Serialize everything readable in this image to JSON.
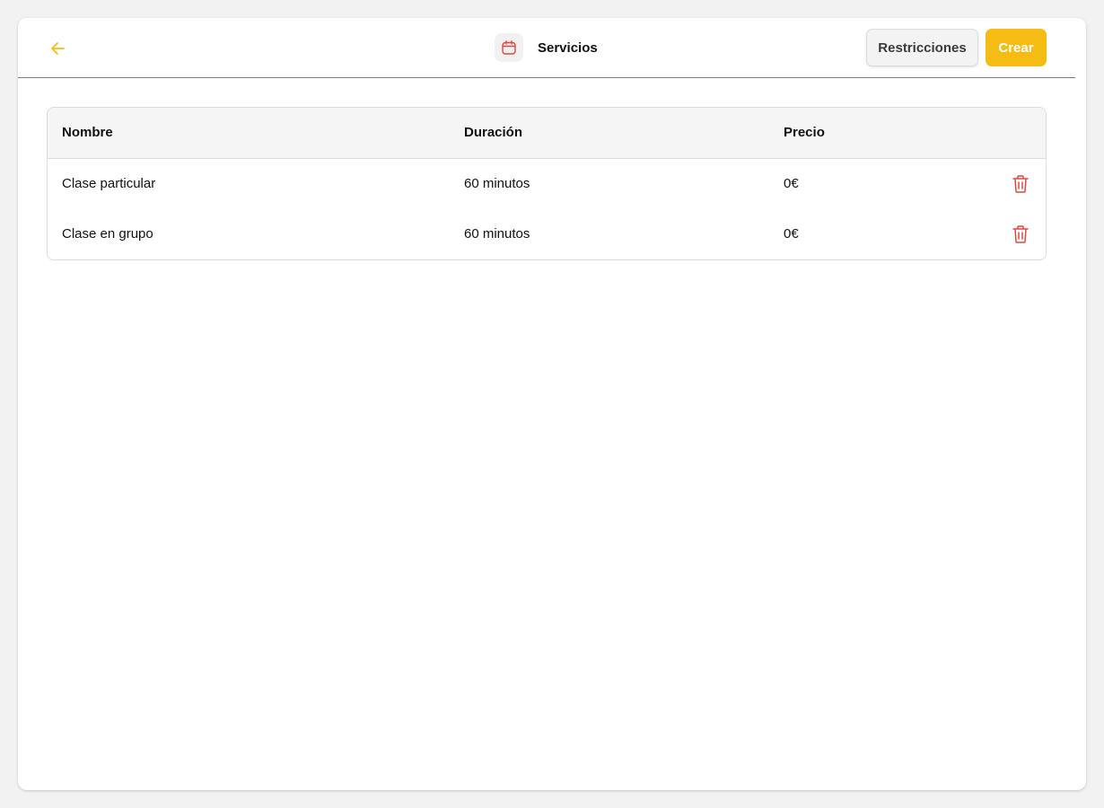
{
  "header": {
    "title": "Servicios",
    "title_icon": "calendar-icon",
    "back_icon": "arrow-left-icon",
    "restrictions_label": "Restricciones",
    "create_label": "Crear"
  },
  "table": {
    "columns": [
      "Nombre",
      "Duración",
      "Precio"
    ],
    "rows": [
      {
        "name": "Clase particular",
        "duration": "60 minutos",
        "price": "0€",
        "action_icon": "trash-icon"
      },
      {
        "name": "Clase en grupo",
        "duration": "60 minutos",
        "price": "0€",
        "action_icon": "trash-icon"
      }
    ]
  },
  "colors": {
    "accent": "#f5bd14",
    "danger": "#e0483e",
    "background": "#f2f2f2",
    "card": "#ffffff"
  }
}
